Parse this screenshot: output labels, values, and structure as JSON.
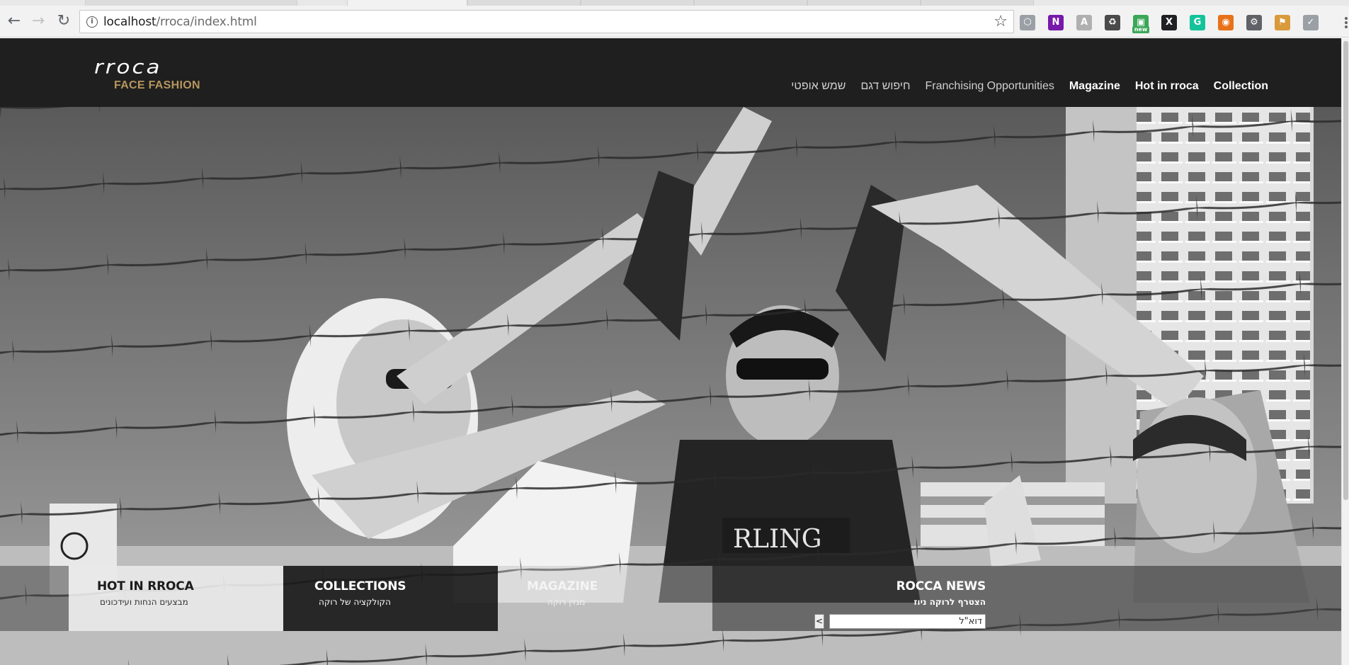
{
  "browser": {
    "url_host": "localhost",
    "url_path": "/rroca/index.html",
    "back_icon": "arrow-left-icon",
    "forward_icon": "arrow-right-icon",
    "reload_icon": "reload-icon",
    "star_icon": "bookmark-star-icon",
    "extensions": [
      {
        "name": "cube-extension-icon",
        "glyph": "⬡",
        "color": "#9aa0a6"
      },
      {
        "name": "onenote-extension-icon",
        "glyph": "N",
        "color": "#7719aa"
      },
      {
        "name": "angular-extension-icon",
        "glyph": "A",
        "color": "#b0b0b0"
      },
      {
        "name": "recycle-extension-icon",
        "glyph": "♻",
        "color": "#4a4a4a"
      },
      {
        "name": "new-badge-extension-icon",
        "glyph": "▣",
        "color": "#3aa757",
        "badge": "new"
      },
      {
        "name": "x-extension-icon",
        "glyph": "X",
        "color": "#202124"
      },
      {
        "name": "grammarly-extension-icon",
        "glyph": "G",
        "color": "#15c39a"
      },
      {
        "name": "chrome-color-extension-icon",
        "glyph": "◉",
        "color": "#e8711a"
      },
      {
        "name": "gear-extension-icon",
        "glyph": "⚙",
        "color": "#5f6368"
      },
      {
        "name": "tag-extension-icon",
        "glyph": "⚑",
        "color": "#d99a3b"
      },
      {
        "name": "cloud-check-extension-icon",
        "glyph": "✓",
        "color": "#9aa0a6"
      }
    ]
  },
  "header": {
    "logo_wordmark": "rroca",
    "logo_tagline": "FACE FASHION",
    "nav": [
      {
        "label": "Collection",
        "style": "bold"
      },
      {
        "label": "Hot in rroca",
        "style": "bold"
      },
      {
        "label": "Magazine",
        "style": "bold"
      },
      {
        "label": "Franchising Opportunities",
        "style": "light"
      },
      {
        "label": "חיפוש דגם",
        "style": "light"
      },
      {
        "label": "שמש אופטי",
        "style": "light"
      }
    ]
  },
  "tiles": {
    "hot": {
      "title": "HOT IN RROCA",
      "subtitle": "מבצעים הנחות ועידכונים"
    },
    "collections": {
      "title": "COLLECTIONS",
      "subtitle": "הקולקציה של רוקה"
    },
    "magazine": {
      "title": "MAGAZINE",
      "subtitle": "מגזין רוקה"
    },
    "news": {
      "title": "ROCCA NEWS",
      "subtitle": "הצטרף לרוקה ניוז",
      "email_value": "דוא\"ל",
      "submit_label": "<"
    }
  },
  "colors": {
    "header_bg": "#1f1f1f",
    "tagline_gold": "#b6965e"
  }
}
